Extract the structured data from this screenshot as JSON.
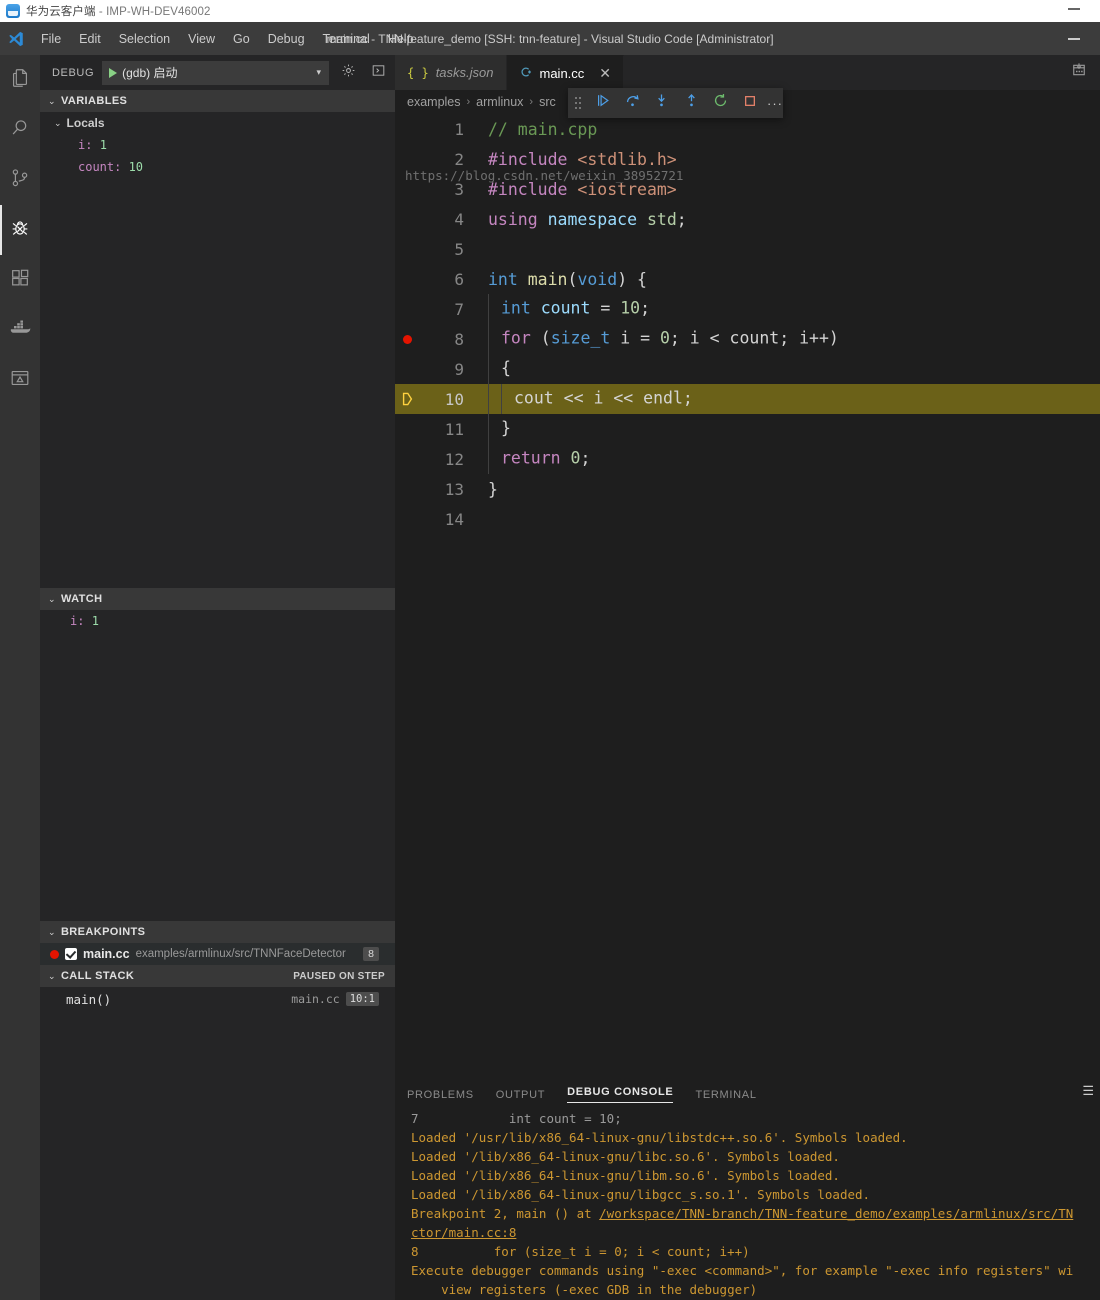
{
  "host_window": {
    "app_name": "华为云客户端",
    "separator": " - ",
    "machine": "IMP-WH-DEV46002",
    "minimize_label": "minimize"
  },
  "vscode_window": {
    "title": "main.cc - TNN-feature_demo [SSH: tnn-feature] - Visual Studio Code [Administrator]",
    "menu": [
      {
        "label": "File"
      },
      {
        "label": "Edit"
      },
      {
        "label": "Selection"
      },
      {
        "label": "View"
      },
      {
        "label": "Go"
      },
      {
        "label": "Debug"
      },
      {
        "label": "Terminal"
      },
      {
        "label": "Help"
      }
    ]
  },
  "activity_bar": {
    "items": [
      {
        "name": "explorer",
        "title": "Explorer",
        "active": false
      },
      {
        "name": "search",
        "title": "Search",
        "active": false
      },
      {
        "name": "source-control",
        "title": "Source Control",
        "active": false
      },
      {
        "name": "run-and-debug",
        "title": "Run and Debug",
        "active": true
      },
      {
        "name": "extensions",
        "title": "Extensions",
        "active": false
      },
      {
        "name": "docker",
        "title": "Docker",
        "active": false
      },
      {
        "name": "remote-explorer",
        "title": "Remote Explorer",
        "active": false
      }
    ]
  },
  "sidebar": {
    "view_title": "DEBUG",
    "launch_configuration": "(gdb) 启动",
    "launch_dropdown_caret": "▾",
    "gear_tooltip": "Open launch.json",
    "open_debug_console_tooltip": "Open Debug Console",
    "variables": {
      "header": "VARIABLES",
      "scopes": [
        {
          "name": "Locals",
          "variables": [
            {
              "name": "i",
              "value": "1"
            },
            {
              "name": "count",
              "value": "10"
            }
          ]
        }
      ]
    },
    "watch": {
      "header": "WATCH",
      "expressions": [
        {
          "name": "i",
          "value": "1"
        }
      ]
    },
    "breakpoints": {
      "header": "BREAKPOINTS",
      "items": [
        {
          "enabled": true,
          "file": "main.cc",
          "path": "examples/armlinux/src/TNNFaceDetector",
          "line": "8"
        }
      ]
    },
    "call_stack": {
      "header": "CALL STACK",
      "status": "PAUSED ON STEP",
      "frames": [
        {
          "name": "main()",
          "source": "main.cc",
          "position": "10:1"
        }
      ]
    }
  },
  "editor": {
    "tabs": [
      {
        "label": "tasks.json",
        "icon": "json-icon",
        "active": false,
        "closable": false
      },
      {
        "label": "main.cc",
        "icon": "cpp-icon",
        "active": true,
        "closable": true,
        "close_glyph": "✕"
      }
    ],
    "tabbar_action_icon": "split-editor-icon",
    "breadcrumbs": [
      "examples",
      "armlinux",
      "src"
    ],
    "breadcrumb_separator": "›",
    "debug_toolbar": {
      "buttons": [
        {
          "name": "drag-handle",
          "label": "Drag"
        },
        {
          "name": "continue",
          "label": "Continue (F5)"
        },
        {
          "name": "step-over",
          "label": "Step Over (F10)"
        },
        {
          "name": "step-into",
          "label": "Step Into (F11)"
        },
        {
          "name": "step-out",
          "label": "Step Out (Shift+F11)"
        },
        {
          "name": "restart",
          "label": "Restart (Ctrl+Shift+F5)"
        },
        {
          "name": "stop",
          "label": "Stop (Shift+F5)"
        }
      ],
      "overflow_glyph": "···"
    },
    "lines": [
      {
        "num": "1",
        "breakpoint": false,
        "current": false,
        "indent": 0,
        "tokens": [
          {
            "t": "// main.cpp",
            "c": "cmt"
          }
        ]
      },
      {
        "num": "2",
        "breakpoint": false,
        "current": false,
        "indent": 0,
        "tokens": [
          {
            "t": "#include ",
            "c": "kw2"
          },
          {
            "t": "<stdlib.h>",
            "c": "str"
          }
        ]
      },
      {
        "num": "3",
        "breakpoint": false,
        "current": false,
        "indent": 0,
        "tokens": [
          {
            "t": "#include ",
            "c": "kw2"
          },
          {
            "t": "<iostream>",
            "c": "str"
          }
        ]
      },
      {
        "num": "4",
        "breakpoint": false,
        "current": false,
        "indent": 0,
        "tokens": [
          {
            "t": "using ",
            "c": "kw2"
          },
          {
            "t": "namespace ",
            "c": "id"
          },
          {
            "t": "std",
            "c": "num"
          },
          {
            "t": ";",
            "c": "pl"
          }
        ]
      },
      {
        "num": "5",
        "breakpoint": false,
        "current": false,
        "indent": 0,
        "tokens": []
      },
      {
        "num": "6",
        "breakpoint": false,
        "current": false,
        "indent": 0,
        "tokens": [
          {
            "t": "int ",
            "c": "kw"
          },
          {
            "t": "main",
            "c": "fn"
          },
          {
            "t": "(",
            "c": "pl"
          },
          {
            "t": "void",
            "c": "kw"
          },
          {
            "t": ") {",
            "c": "pl"
          }
        ]
      },
      {
        "num": "7",
        "breakpoint": false,
        "current": false,
        "indent": 1,
        "tokens": [
          {
            "t": "int ",
            "c": "kw"
          },
          {
            "t": "count ",
            "c": "id"
          },
          {
            "t": "= ",
            "c": "pl"
          },
          {
            "t": "10",
            "c": "num"
          },
          {
            "t": ";",
            "c": "pl"
          }
        ]
      },
      {
        "num": "8",
        "breakpoint": true,
        "current": false,
        "indent": 1,
        "tokens": [
          {
            "t": "for ",
            "c": "kw2"
          },
          {
            "t": "(",
            "c": "pl"
          },
          {
            "t": "size_t ",
            "c": "kw"
          },
          {
            "t": "i ",
            "c": "pl"
          },
          {
            "t": "= ",
            "c": "pl"
          },
          {
            "t": "0",
            "c": "num"
          },
          {
            "t": "; i < ",
            "c": "pl"
          },
          {
            "t": "count",
            "c": "pl"
          },
          {
            "t": "; i++)",
            "c": "pl"
          }
        ]
      },
      {
        "num": "9",
        "breakpoint": false,
        "current": false,
        "indent": 1,
        "tokens": [
          {
            "t": "{",
            "c": "pl"
          }
        ]
      },
      {
        "num": "10",
        "breakpoint": false,
        "current": true,
        "indent": 2,
        "tokens": [
          {
            "t": "cout << i << endl;",
            "c": "pl"
          }
        ]
      },
      {
        "num": "11",
        "breakpoint": false,
        "current": false,
        "indent": 1,
        "tokens": [
          {
            "t": "}",
            "c": "pl"
          }
        ]
      },
      {
        "num": "12",
        "breakpoint": false,
        "current": false,
        "indent": 1,
        "tokens": [
          {
            "t": "return ",
            "c": "kw2"
          },
          {
            "t": "0",
            "c": "num"
          },
          {
            "t": ";",
            "c": "pl"
          }
        ]
      },
      {
        "num": "13",
        "breakpoint": false,
        "current": false,
        "indent": 0,
        "tokens": [
          {
            "t": "}",
            "c": "pl"
          }
        ]
      },
      {
        "num": "14",
        "breakpoint": false,
        "current": false,
        "indent": 0,
        "tokens": []
      }
    ]
  },
  "panel": {
    "tabs": [
      {
        "label": "PROBLEMS",
        "active": false
      },
      {
        "label": "OUTPUT",
        "active": false
      },
      {
        "label": "DEBUG CONSOLE",
        "active": true
      },
      {
        "label": "TERMINAL",
        "active": false
      }
    ],
    "console_lines": [
      {
        "segments": [
          {
            "t": "7            int count = 10;",
            "c": "c-grey"
          }
        ]
      },
      {
        "segments": [
          {
            "t": "Loaded '/usr/lib/x86_64-linux-gnu/libstdc++.so.6'. Symbols loaded.",
            "c": "c-amber"
          }
        ]
      },
      {
        "segments": [
          {
            "t": "Loaded '/lib/x86_64-linux-gnu/libc.so.6'. Symbols loaded.",
            "c": "c-amber"
          }
        ]
      },
      {
        "segments": [
          {
            "t": "Loaded '/lib/x86_64-linux-gnu/libm.so.6'. Symbols loaded.",
            "c": "c-amber"
          }
        ]
      },
      {
        "segments": [
          {
            "t": "Loaded '/lib/x86_64-linux-gnu/libgcc_s.so.1'. Symbols loaded.",
            "c": "c-amber"
          }
        ]
      },
      {
        "segments": [
          {
            "t": "",
            "c": "c-amber"
          }
        ]
      },
      {
        "segments": [
          {
            "t": "Breakpoint 2, main () at ",
            "c": "c-amber"
          },
          {
            "t": "/workspace/TNN-branch/TNN-feature_demo/examples/armlinux/src/TN",
            "c": "c-link"
          }
        ]
      },
      {
        "segments": [
          {
            "t": "ctor/main.cc:8",
            "c": "c-link"
          }
        ]
      },
      {
        "segments": [
          {
            "t": "8          for (size_t i = 0; i < count; i++)",
            "c": "c-amber"
          }
        ]
      },
      {
        "segments": [
          {
            "t": "Execute debugger commands using \"-exec <command>\", for example \"-exec info registers\" wi",
            "c": "c-amber"
          }
        ]
      },
      {
        "segments": [
          {
            "t": "    view registers (-exec GDB in the debugger)",
            "c": "c-amber"
          }
        ]
      }
    ],
    "watermark": "https://blog.csdn.net/weixin_38952721",
    "menu_glyph": "☰"
  }
}
